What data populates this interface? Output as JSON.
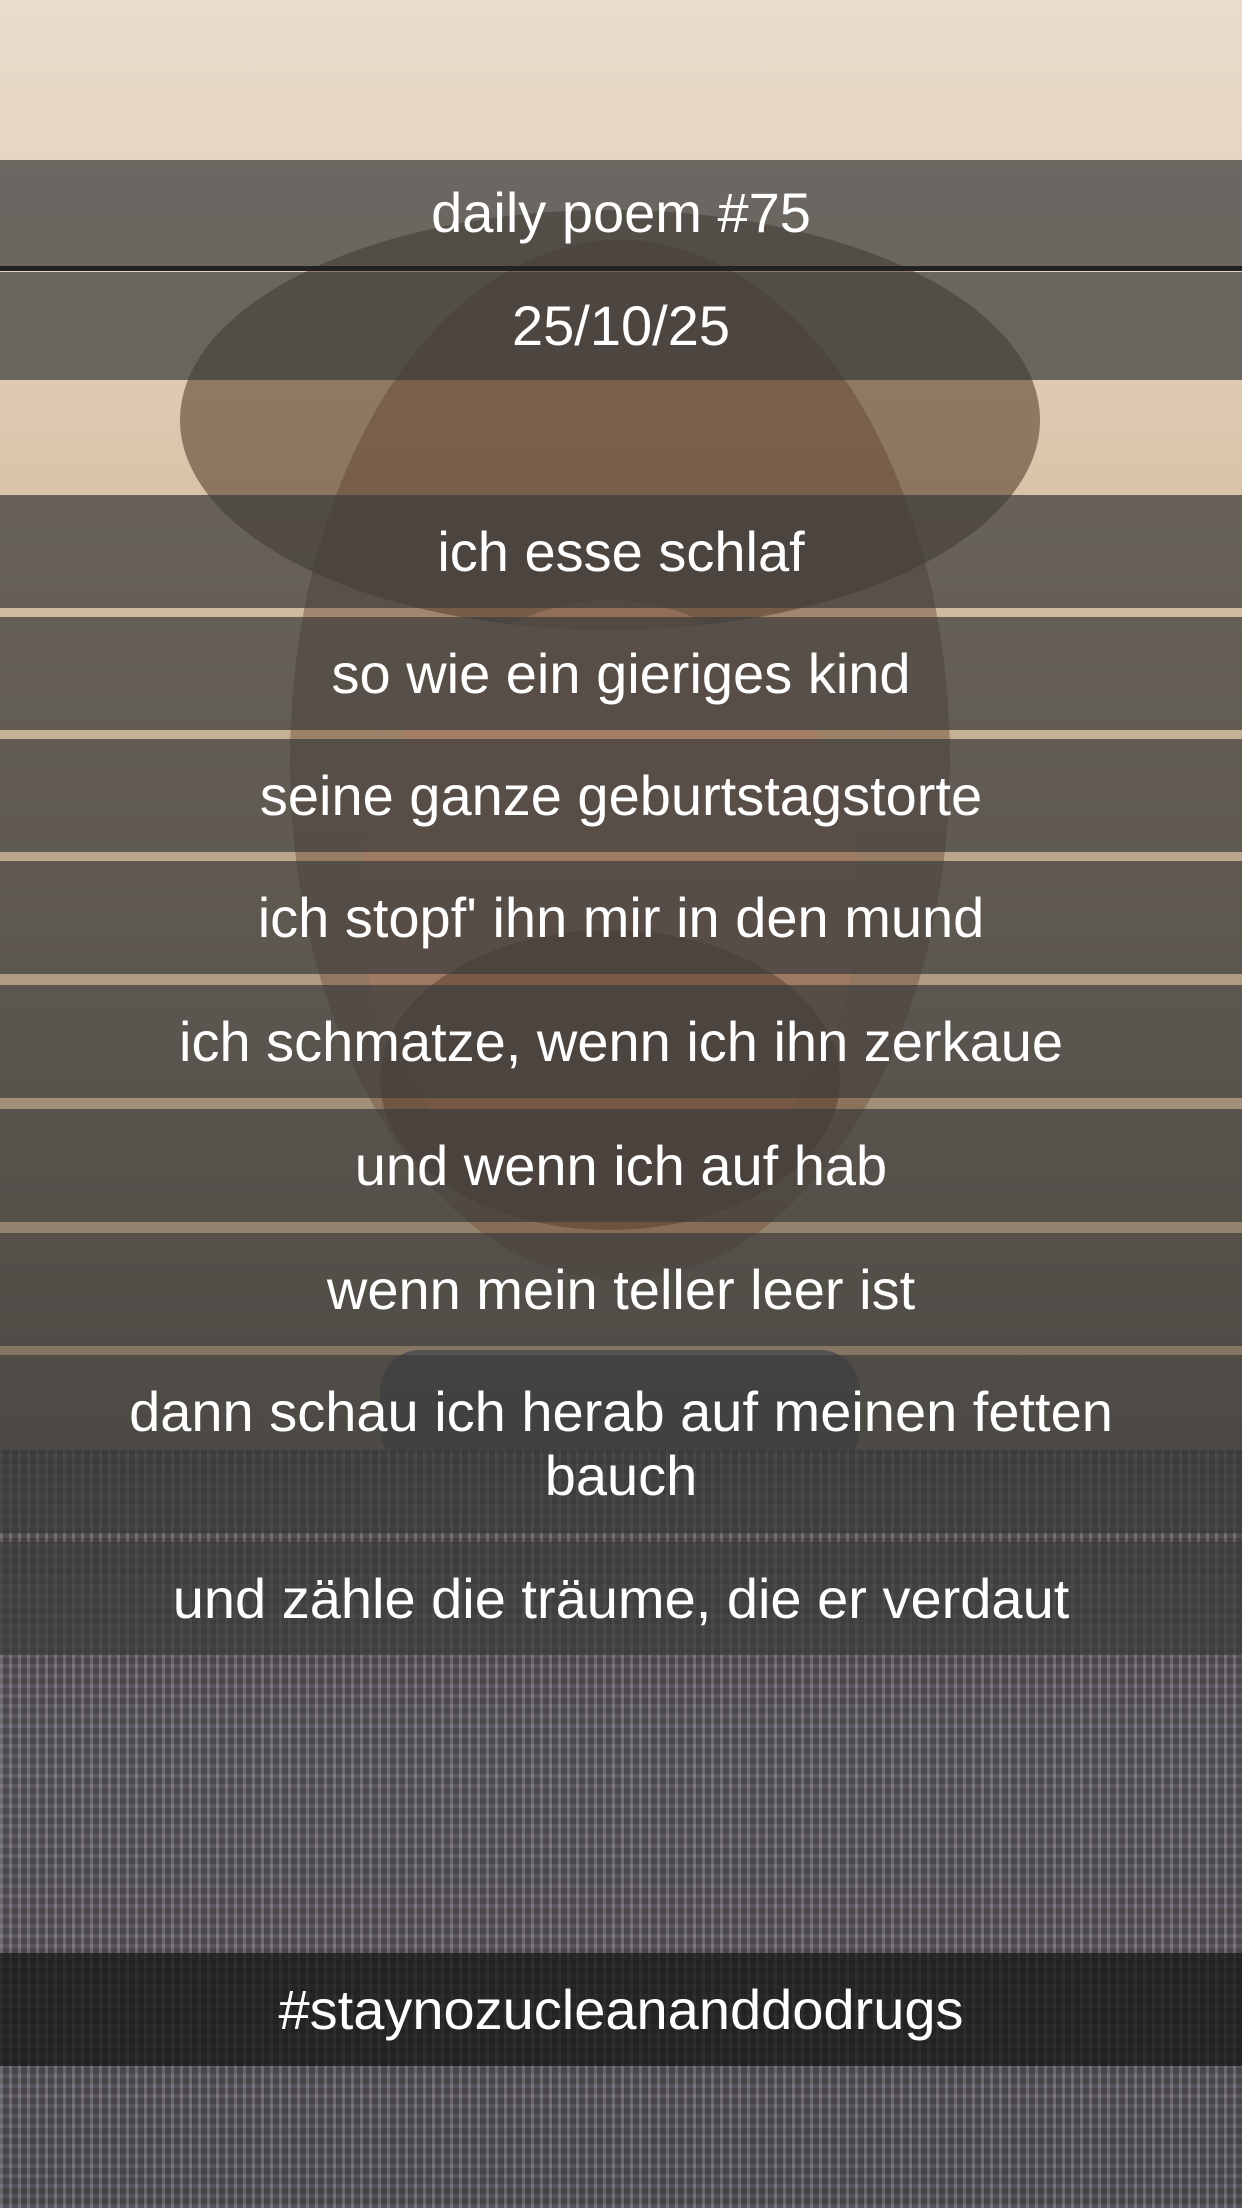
{
  "header": {
    "title": "daily poem #75",
    "date": "25/10/25"
  },
  "poem": {
    "lines": [
      "ich esse schlaf",
      "so wie ein gieriges kind",
      "seine ganze geburtstagstorte",
      "ich stopf' ihn mir in den mund",
      "ich schmatze, wenn ich ihn zerkaue",
      "und wenn ich auf hab",
      "wenn mein teller leer ist",
      "dann schau ich herab auf meinen fetten bauch",
      "und zähle die träume, die er verdaut"
    ]
  },
  "footer": {
    "hashtag": "#staynozucleananddodrugs"
  },
  "colors": {
    "band": "#3c3c3c",
    "text": "#ffffff"
  }
}
